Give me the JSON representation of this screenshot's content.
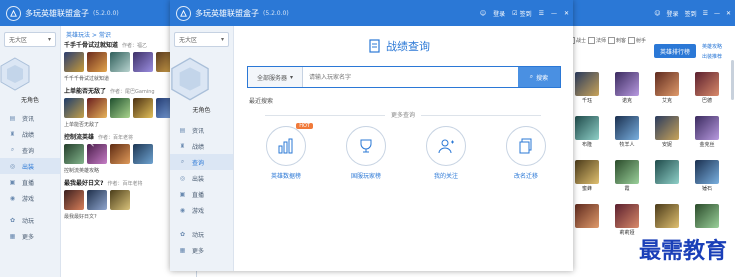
{
  "app": {
    "title": "多玩英雄联盟盒子",
    "version": "(5.2.0.0)"
  },
  "left": {
    "region": "无大区",
    "no_hero": "无角色",
    "breadcrumb": "英雄玩法 > 常识",
    "nav": [
      {
        "label": "资讯",
        "icon": "news-icon"
      },
      {
        "label": "战绩",
        "icon": "trophy-icon"
      },
      {
        "label": "查询",
        "icon": "search-icon"
      },
      {
        "label": "出装",
        "icon": "equip-icon"
      },
      {
        "label": "直播",
        "icon": "tv-icon"
      },
      {
        "label": "游戏",
        "icon": "gamepad-icon"
      },
      {
        "label": "动玩",
        "icon": "gift-icon"
      },
      {
        "label": "更多",
        "icon": "grid-icon"
      }
    ],
    "articles": [
      {
        "title": "千手千骨试过就知道",
        "meta": "作者：福乙",
        "caption": "千千千骨试过就知道"
      },
      {
        "title": "上单能否无敌了",
        "meta": "作者：尾巴Gaming",
        "caption": "上单能否无敌了"
      },
      {
        "title": "控制流英雄",
        "meta": "作者：百年老将",
        "caption": "控制流英雄攻略"
      },
      {
        "title": "最我最好日文?",
        "meta": "作者：百年老将",
        "caption": "最我最好日文?"
      }
    ]
  },
  "middle": {
    "region": "无大区",
    "no_hero": "无角色",
    "header_links": [
      "登录",
      "签到"
    ],
    "nav": [
      {
        "label": "资讯"
      },
      {
        "label": "战绩"
      },
      {
        "label": "查询"
      },
      {
        "label": "出装"
      },
      {
        "label": "直播"
      },
      {
        "label": "游戏"
      },
      {
        "label": "动玩"
      },
      {
        "label": "更多"
      }
    ],
    "query_title": "战绩查询",
    "server_select": "全部服务器",
    "search_placeholder": "请输入玩家名字",
    "search_button": "搜索",
    "recent_label": "最近搜索",
    "more_label": "更多查询",
    "hot_badge": "HOT",
    "query_items": [
      {
        "label": "英雄数据榜",
        "icon": "bar-chart-icon"
      },
      {
        "label": "国服玩家榜",
        "icon": "trophy-cup-icon"
      },
      {
        "label": "我的关注",
        "icon": "user-add-icon"
      },
      {
        "label": "改名迁移",
        "icon": "document-stack-icon"
      }
    ]
  },
  "right": {
    "header_links": [
      "登录",
      "签到"
    ],
    "filters": [
      "战士",
      "法师",
      "刺客",
      "射手"
    ],
    "hero_button": "英雄排行榜",
    "links": [
      "英雄攻略",
      "出装推荐"
    ],
    "heroes": [
      [
        "",
        "",
        "",
        ""
      ],
      [
        "千珏",
        "诺克",
        "艾克",
        "巴德"
      ],
      [
        "",
        "",
        "",
        ""
      ],
      [
        "布隆",
        "牧羊人",
        "安妮",
        "金克丝"
      ],
      [
        "",
        "",
        "",
        ""
      ],
      [
        "蜜蜂",
        "霞",
        "",
        "锤石"
      ],
      [
        "",
        "",
        "",
        ""
      ],
      [
        "",
        "莉莉娅",
        "",
        ""
      ]
    ],
    "watermark": "最需教育"
  },
  "colors": {
    "brand": "#2b78d6",
    "hot": "#f07a3a",
    "sidebar": "#edf2f8"
  }
}
